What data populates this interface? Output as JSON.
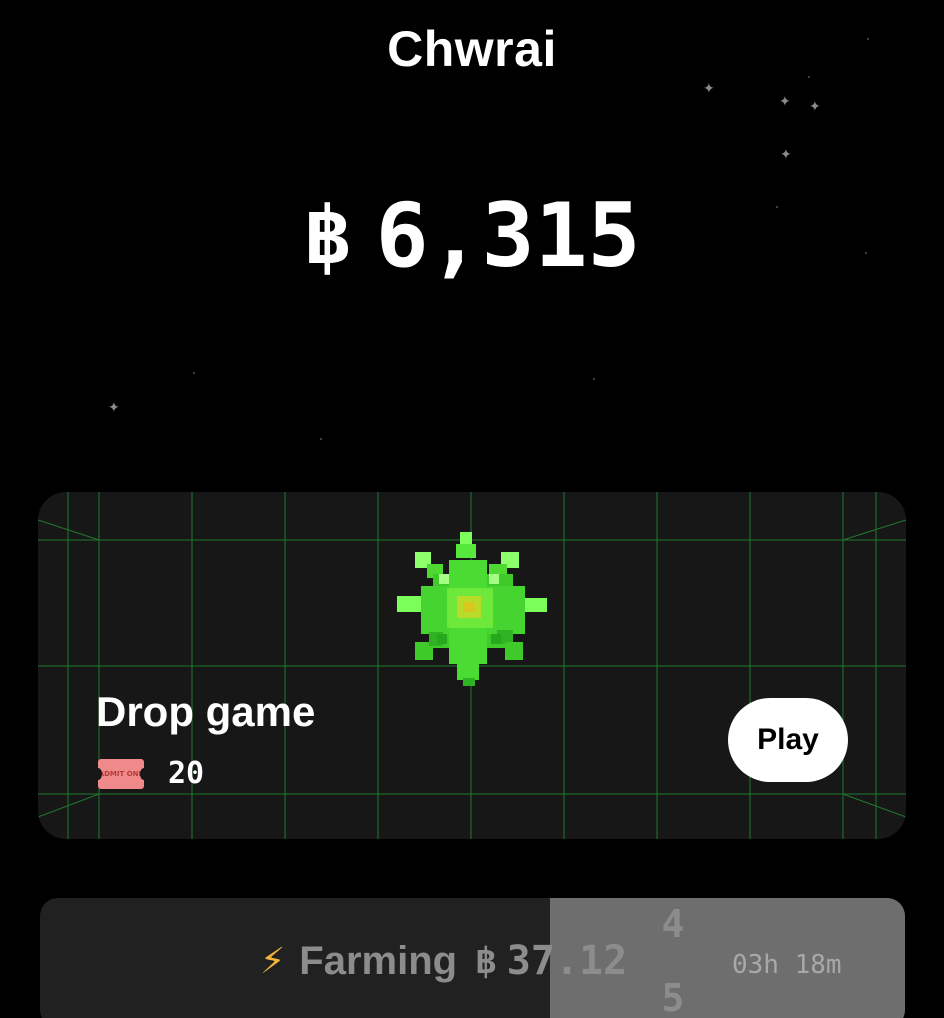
{
  "header": {
    "user_name": "Chwrai"
  },
  "balance": {
    "currency_symbol": "฿",
    "amount": "6,315"
  },
  "drop_game": {
    "title": "Drop game",
    "ticket_icon": "ticket-icon",
    "ticket_text": "ADMIT ONE",
    "tickets": "20",
    "play_label": "Play",
    "accent_color": "#2ecc40",
    "grid_color": "#1f7a2e"
  },
  "farming": {
    "icon": "lightning-icon",
    "label": "Farming",
    "currency_symbol": "฿",
    "amount": "37.12",
    "rolling_digit_upper": "4",
    "rolling_digit_lower": "5",
    "timer": "03h 18m",
    "progress": 0.41
  },
  "colors": {
    "background": "#000000",
    "card": "#171717",
    "farming_bar": "#212121",
    "farming_fill": "#6e6e6e",
    "bolt": "#f2b43a"
  }
}
